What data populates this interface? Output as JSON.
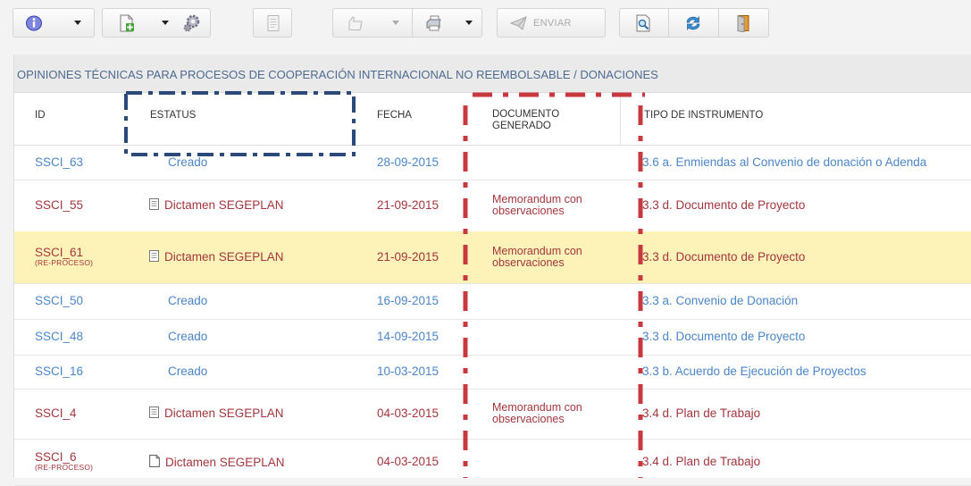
{
  "toolbar": {
    "send_label": "ENVIAR",
    "icons": [
      "info-icon",
      "new-document-icon",
      "gear-icon",
      "notes-icon",
      "hand-icon",
      "printer-icon",
      "send-arrow-icon",
      "search-document-icon",
      "refresh-icon",
      "exit-door-icon"
    ]
  },
  "panel": {
    "title": "OPINIONES TÉCNICAS PARA PROCESOS DE COOPERACIÓN INTERNACIONAL NO REEMBOLSABLE / DONACIONES"
  },
  "table": {
    "headers": {
      "id": "ID",
      "estatus": "ESTATUS",
      "fecha": "FECHA",
      "documento_1": "DOCUMENTO",
      "documento_2": "GENERADO",
      "tipo": "TIPO DE INSTRUMENTO"
    },
    "rows": [
      {
        "id": "SSCI_63",
        "sub": "",
        "estatus": "Creado",
        "fecha": "28-09-2015",
        "doc1": "",
        "doc2": "",
        "tipo": "3.6 a. Enmiendas al Convenio de donación o Adenda"
      },
      {
        "id": "SSCI_55",
        "sub": "",
        "estatus": "Dictamen SEGEPLAN",
        "fecha": "21-09-2015",
        "doc1": "Memorandum con",
        "doc2": "observaciones",
        "tipo": "3.3 d. Documento de Proyecto"
      },
      {
        "id": "SSCI_61",
        "sub": "(RE-PROCESO)",
        "estatus": "Dictamen SEGEPLAN",
        "fecha": "21-09-2015",
        "doc1": "Memorandum con",
        "doc2": "observaciones",
        "tipo": "3.3 d. Documento de Proyecto"
      },
      {
        "id": "SSCI_50",
        "sub": "",
        "estatus": "Creado",
        "fecha": "16-09-2015",
        "doc1": "",
        "doc2": "",
        "tipo": "3.3 a. Convenio de Donación"
      },
      {
        "id": "SSCI_48",
        "sub": "",
        "estatus": "Creado",
        "fecha": "14-09-2015",
        "doc1": "",
        "doc2": "",
        "tipo": "3.3 d. Documento de Proyecto"
      },
      {
        "id": "SSCI_16",
        "sub": "",
        "estatus": "Creado",
        "fecha": "10-03-2015",
        "doc1": "",
        "doc2": "",
        "tipo": "3.3 b. Acuerdo de Ejecución de Proyectos"
      },
      {
        "id": "SSCI_4",
        "sub": "",
        "estatus": "Dictamen SEGEPLAN",
        "fecha": "04-03-2015",
        "doc1": "Memorandum con",
        "doc2": "observaciones",
        "tipo": "3.4 d. Plan de Trabajo"
      },
      {
        "id": "SSCI_6",
        "sub": "(RE-PROCESO)",
        "estatus": "Dictamen SEGEPLAN",
        "fecha": "04-03-2015",
        "doc1": "",
        "doc2": "",
        "tipo": "3.4 d. Plan de Trabajo"
      }
    ]
  },
  "colors": {
    "link_blue": "#4a86c9",
    "dark_red": "#a4363d",
    "highlight_row": "#fdf3b8",
    "title_text": "#4d6a8f",
    "overlay_blue": "#2b4a7a",
    "overlay_red": "#c8393f"
  }
}
